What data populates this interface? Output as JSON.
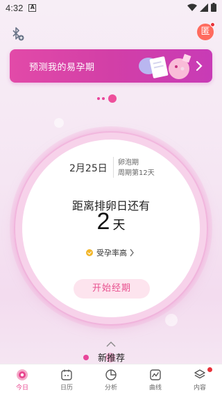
{
  "status_bar": {
    "time": "4:32",
    "notif_letter": "A"
  },
  "header": {
    "right_icon_label": "匿"
  },
  "banner": {
    "text": "预测我的易孕期"
  },
  "cycle": {
    "date": "2月25日",
    "phase": "卵泡期",
    "cycle_day": "周期第12天",
    "countdown_label": "距离排卵日还有",
    "countdown_number": "2",
    "countdown_unit": "天",
    "fertility_text": "受孕率高",
    "start_button": "开始经期"
  },
  "recommend": {
    "title": "新推荐"
  },
  "bottom_nav": {
    "items": [
      {
        "label": "今日"
      },
      {
        "label": "日历"
      },
      {
        "label": "分析"
      },
      {
        "label": "曲线"
      },
      {
        "label": "内容"
      }
    ],
    "active_index": 0
  },
  "colors": {
    "accent": "#e8458f",
    "banner": "#d23fa7"
  }
}
